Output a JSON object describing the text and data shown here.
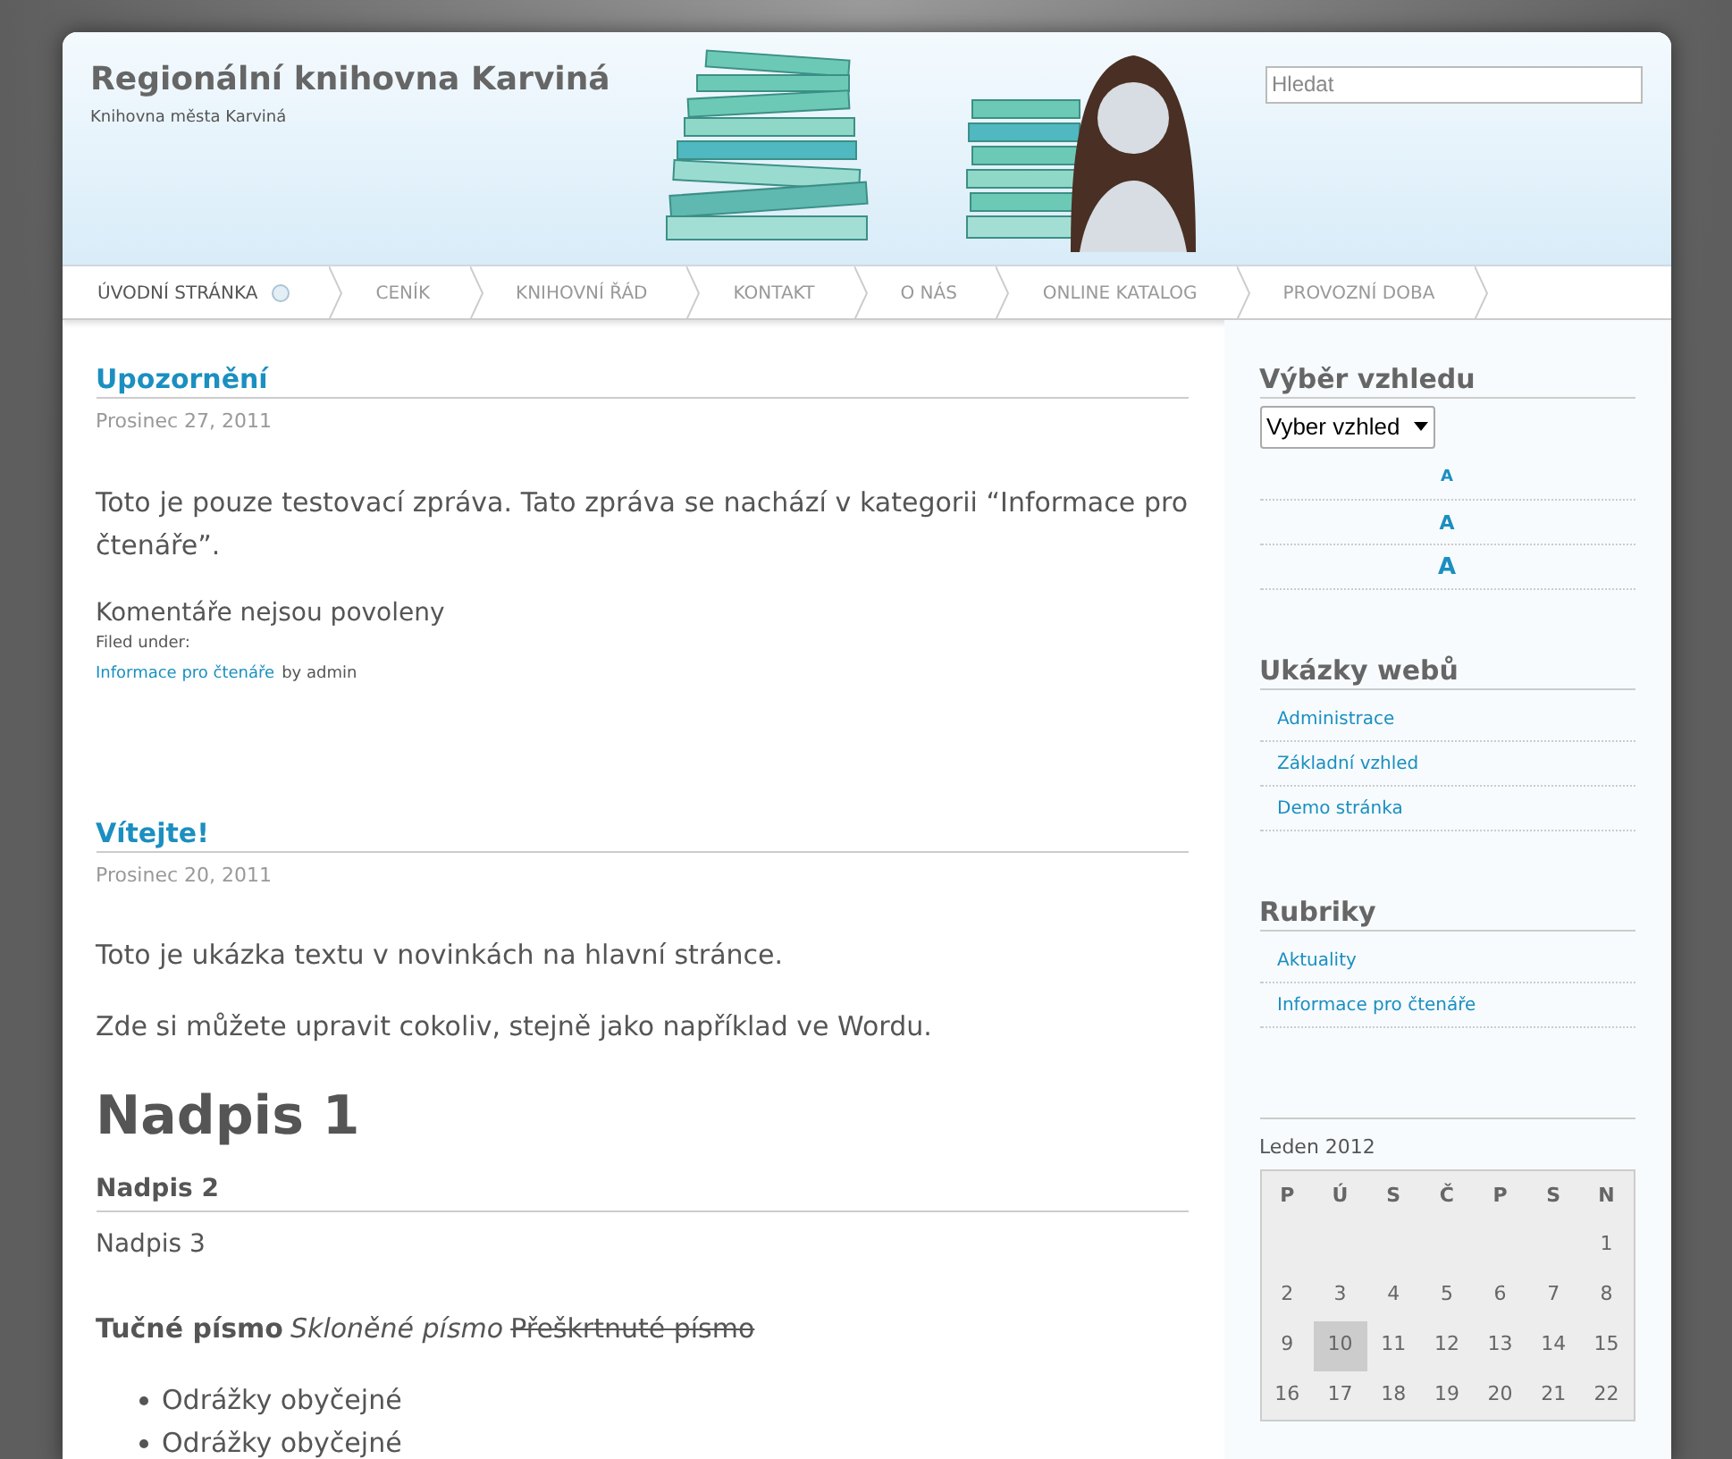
{
  "site": {
    "title": "Regionální knihovna Karviná",
    "tagline": "Knihovna města Karviná"
  },
  "search": {
    "placeholder": "Hledat"
  },
  "nav": [
    {
      "label": "ÚVODNÍ STRÁNKA",
      "selected": true
    },
    {
      "label": "CENÍK",
      "selected": false
    },
    {
      "label": "KNIHOVNÍ ŘÁD",
      "selected": false
    },
    {
      "label": "KONTAKT",
      "selected": false
    },
    {
      "label": "O NÁS",
      "selected": false
    },
    {
      "label": "ONLINE KATALOG",
      "selected": false
    },
    {
      "label": "PROVOZNÍ DOBA",
      "selected": false
    }
  ],
  "posts": [
    {
      "title": "Upozornění",
      "date": "Prosinec 27, 2011",
      "blocks": [
        {
          "kind": "paragraph",
          "text": "Toto je pouze testovací zpráva. Tato zpráva se nachází v kategorii “Informace pro čtenáře”."
        }
      ],
      "comments": "Komentáře nejsou povoleny",
      "filed_label": "Filed under:",
      "category": "Informace pro čtenáře",
      "author": "by admin"
    },
    {
      "title": "Vítejte!",
      "date": "Prosinec 20, 2011",
      "blocks": [
        {
          "kind": "paragraph",
          "text": "Toto je ukázka textu v novinkách na hlavní stránce."
        },
        {
          "kind": "paragraph",
          "text": "Zde si můžete upravit cokoliv, stejně jako například ve Wordu."
        },
        {
          "kind": "h1",
          "text": "Nadpis 1"
        },
        {
          "kind": "h2",
          "text": "Nadpis 2"
        },
        {
          "kind": "h3",
          "text": "Nadpis 3"
        },
        {
          "kind": "formatting",
          "parts": [
            {
              "kind": "bold",
              "text": "Tučné písmo"
            },
            {
              "kind": "italic",
              "text": "Skloněné písmo"
            },
            {
              "kind": "strike",
              "text": "Přeškrtnuté písmo"
            }
          ]
        },
        {
          "kind": "bullets",
          "items": [
            "Odrážky obyčejné",
            "Odrážky obyčejné"
          ]
        }
      ]
    }
  ],
  "sidebar": {
    "appearance": {
      "title": "Výběr vzhledu",
      "select": "Vyber vzhled",
      "font_sizes": [
        "A",
        "A",
        "A"
      ]
    },
    "widgets": [
      {
        "title": "Ukázky webů",
        "links": [
          "Administrace",
          "Základní vzhled",
          "Demo stránka"
        ]
      },
      {
        "title": "Rubriky",
        "links": [
          "Aktuality",
          "Informace pro čtenáře"
        ]
      }
    ],
    "calendar": {
      "caption": "Leden 2012",
      "weekdays": [
        "P",
        "Ú",
        "S",
        "Č",
        "P",
        "S",
        "N"
      ],
      "weeks": [
        [
          {
            "day": "1",
            "selected": false
          }
        ],
        [
          {
            "day": "2",
            "selected": false
          },
          {
            "day": "3",
            "selected": false
          },
          {
            "day": "4",
            "selected": false
          },
          {
            "day": "5",
            "selected": false
          },
          {
            "day": "6",
            "selected": false
          },
          {
            "day": "7",
            "selected": false
          },
          {
            "day": "8",
            "selected": false
          }
        ],
        [
          {
            "day": "9",
            "selected": false
          },
          {
            "day": "10",
            "selected": true
          },
          {
            "day": "11",
            "selected": false
          },
          {
            "day": "12",
            "selected": false
          },
          {
            "day": "13",
            "selected": false
          },
          {
            "day": "14",
            "selected": false
          },
          {
            "day": "15",
            "selected": false
          }
        ],
        [
          {
            "day": "16",
            "selected": false
          },
          {
            "day": "17",
            "selected": false
          },
          {
            "day": "18",
            "selected": false
          },
          {
            "day": "19",
            "selected": false
          },
          {
            "day": "20",
            "selected": false
          },
          {
            "day": "21",
            "selected": false
          },
          {
            "day": "22",
            "selected": false
          }
        ]
      ]
    }
  }
}
